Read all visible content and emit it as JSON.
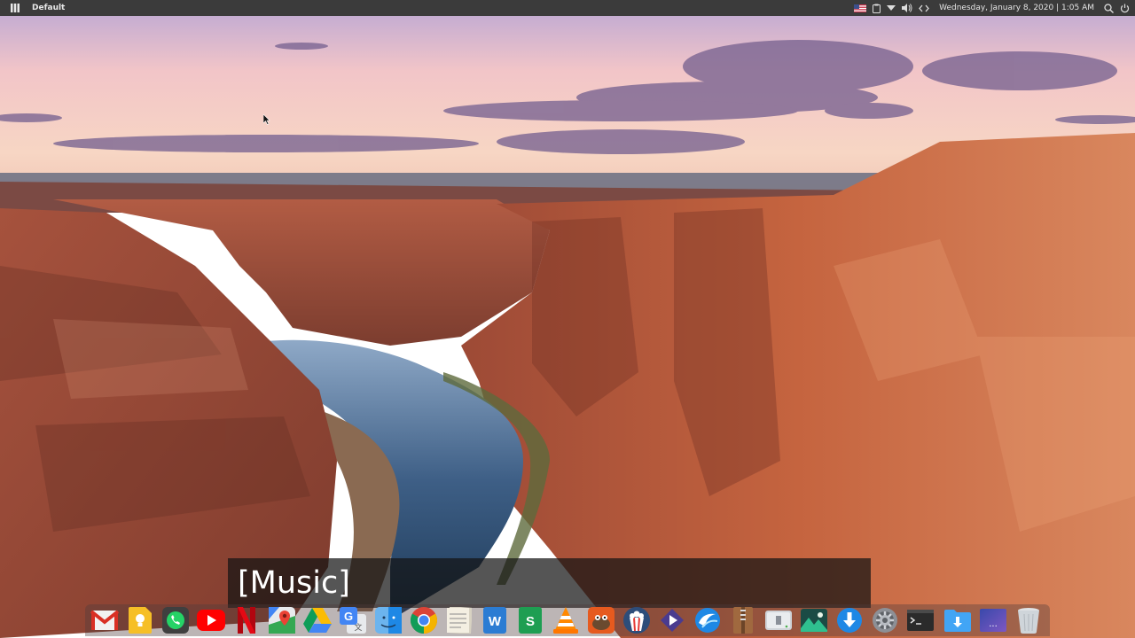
{
  "topbar": {
    "workspace_label": "Default",
    "clock_text": "Wednesday, January 8, 2020 | 1:05 AM",
    "tray_icons": [
      "us-flag-icon",
      "clipboard-icon",
      "network-icon",
      "volume-icon",
      "code-icon",
      "search-icon",
      "power-icon"
    ]
  },
  "caption": {
    "text": "[Music]"
  },
  "dock": {
    "items": [
      {
        "name": "gmail",
        "icon": "gmail-icon"
      },
      {
        "name": "keep",
        "icon": "keep-icon"
      },
      {
        "name": "whatsapp",
        "icon": "whatsapp-icon"
      },
      {
        "name": "youtube",
        "icon": "youtube-icon"
      },
      {
        "name": "netflix",
        "icon": "netflix-icon"
      },
      {
        "name": "maps",
        "icon": "maps-icon"
      },
      {
        "name": "drive",
        "icon": "drive-icon"
      },
      {
        "name": "translate",
        "icon": "translate-icon"
      },
      {
        "name": "finder",
        "icon": "finder-icon"
      },
      {
        "name": "chrome",
        "icon": "chrome-icon"
      },
      {
        "name": "notes",
        "icon": "notes-icon"
      },
      {
        "name": "word",
        "icon": "word-icon"
      },
      {
        "name": "sheets",
        "icon": "sheets-icon"
      },
      {
        "name": "vlc",
        "icon": "vlc-icon"
      },
      {
        "name": "gimp",
        "icon": "gimp-icon"
      },
      {
        "name": "popcorn",
        "icon": "popcorn-icon"
      },
      {
        "name": "kdenlive",
        "icon": "kdenlive-icon"
      },
      {
        "name": "browser",
        "icon": "browser-icon"
      },
      {
        "name": "archive",
        "icon": "archive-icon"
      },
      {
        "name": "usb",
        "icon": "usb-icon"
      },
      {
        "name": "photos",
        "icon": "photos-icon"
      },
      {
        "name": "downloader",
        "icon": "downloader-icon"
      },
      {
        "name": "settings",
        "icon": "settings-icon"
      },
      {
        "name": "terminal",
        "icon": "terminal-icon"
      },
      {
        "name": "downloads-folder",
        "icon": "downloads-folder-icon"
      },
      {
        "name": "workspaces",
        "icon": "workspaces-icon"
      },
      {
        "name": "trash",
        "icon": "trash-icon"
      }
    ]
  },
  "colors": {
    "topbar_bg": "#3b3b3b",
    "sky_top": "#a8a3cf",
    "sky_mid": "#f4c9c4",
    "canyon": "#b65a3b",
    "river": "#3f5f87"
  }
}
